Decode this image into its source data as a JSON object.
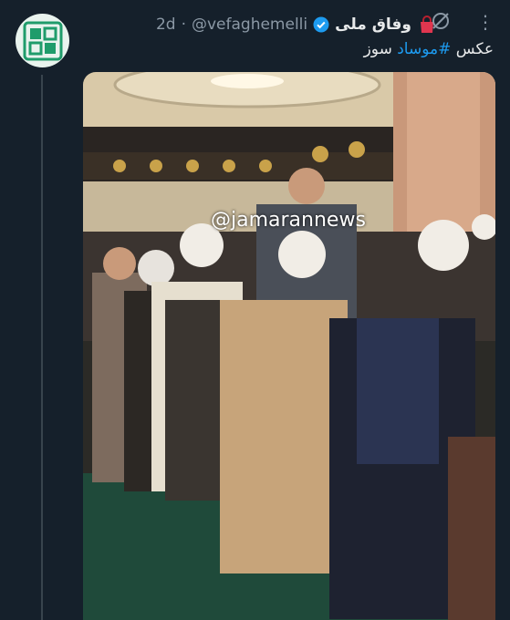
{
  "tweet": {
    "author_name": "وفاق ملی",
    "handle": "@vefaghemelli",
    "separator": "·",
    "time": "2d",
    "text_prefix": "عکس",
    "hashtag": "#موساد",
    "text_suffix": "سوز",
    "accent_color": "#1d9bf0"
  },
  "media": {
    "watermark": "@jamarannews"
  }
}
